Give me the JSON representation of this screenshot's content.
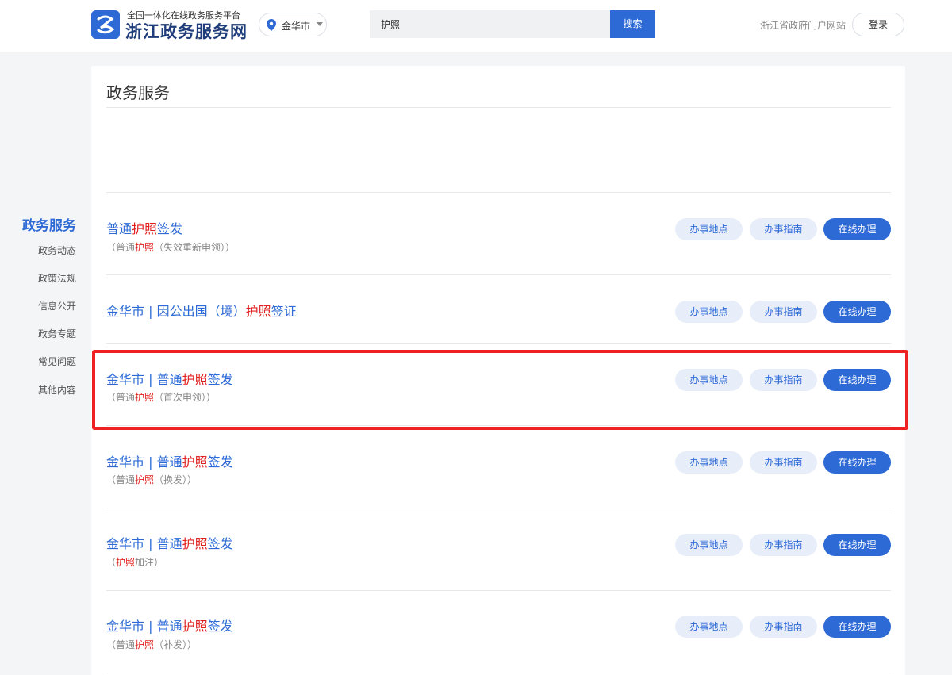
{
  "header": {
    "logo_subtitle": "全国一体化在线政务服务平台",
    "logo_title": "浙江政务服务网",
    "city": "金华市",
    "search_value": "护照",
    "search_button": "搜索",
    "portal_link": "浙江省政府门户网站",
    "login_button": "登录"
  },
  "sidebar": {
    "title": "政务服务",
    "items": [
      "政务动态",
      "政策法规",
      "信息公开",
      "政务专题",
      "常见问题",
      "其他内容"
    ]
  },
  "main": {
    "title": "政务服务",
    "results": [
      {
        "title_pre": "普通",
        "title_hl": "护照",
        "title_post": "签发",
        "sub_pre": "（普通",
        "sub_hl": "护照",
        "sub_post": "（失效重新申领））"
      },
      {
        "title_pre": "金华市 | 因公出国（境）",
        "title_hl": "护照",
        "title_post": "签证",
        "sub_pre": "",
        "sub_hl": "",
        "sub_post": ""
      },
      {
        "title_pre": "金华市 | 普通",
        "title_hl": "护照",
        "title_post": "签发",
        "sub_pre": "（普通",
        "sub_hl": "护照",
        "sub_post": "（首次申领））"
      },
      {
        "title_pre": "金华市 | 普通",
        "title_hl": "护照",
        "title_post": "签发",
        "sub_pre": "（普通",
        "sub_hl": "护照",
        "sub_post": "（换发））"
      },
      {
        "title_pre": "金华市 | 普通",
        "title_hl": "护照",
        "title_post": "签发",
        "sub_pre": "（",
        "sub_hl": "护照",
        "sub_post": "加注）"
      },
      {
        "title_pre": "金华市 | 普通",
        "title_hl": "护照",
        "title_post": "签发",
        "sub_pre": "（普通",
        "sub_hl": "护照",
        "sub_post": "（补发））"
      }
    ],
    "button_location": "办事地点",
    "button_guide": "办事指南",
    "button_online": "在线办理"
  },
  "colors": {
    "accent": "#2d6ad6",
    "highlight": "#e02020",
    "annotation_box": "#ee2222"
  }
}
